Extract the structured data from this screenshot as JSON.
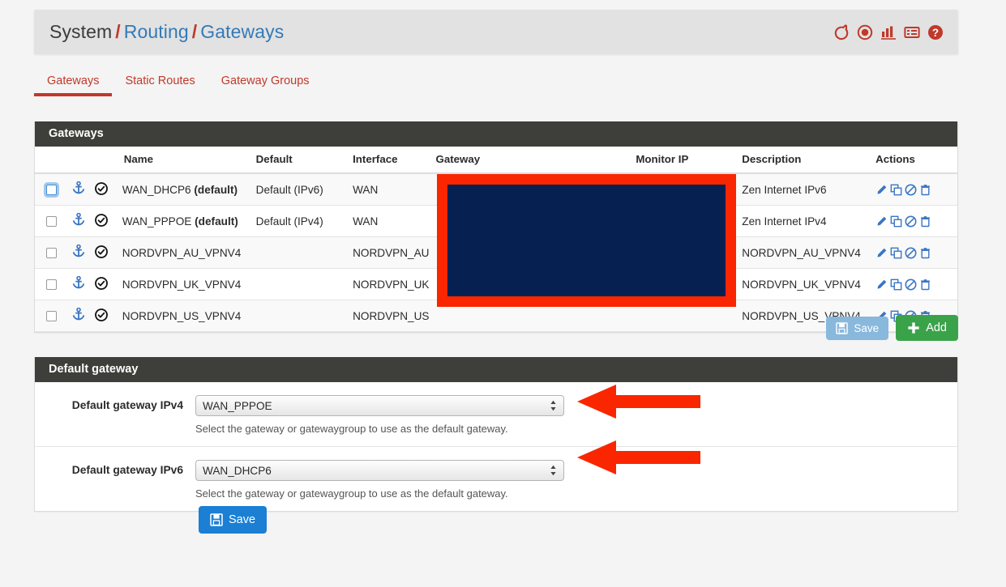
{
  "breadcrumb": {
    "root": "System",
    "sep": "/",
    "mid": "Routing",
    "leaf": "Gateways"
  },
  "header_icons": [
    {
      "name": "refresh-icon"
    },
    {
      "name": "record-stop-icon"
    },
    {
      "name": "chart-icon"
    },
    {
      "name": "log-icon"
    },
    {
      "name": "help-icon"
    }
  ],
  "tabs": [
    {
      "label": "Gateways",
      "active": true
    },
    {
      "label": "Static Routes",
      "active": false
    },
    {
      "label": "Gateway Groups",
      "active": false
    }
  ],
  "gateways_panel": {
    "title": "Gateways",
    "columns": [
      "Name",
      "Default",
      "Interface",
      "Gateway",
      "Monitor IP",
      "Description",
      "Actions"
    ],
    "rows": [
      {
        "name": "WAN_DHCP6",
        "name_suffix": "(default)",
        "default": "Default (IPv6)",
        "interface": "WAN",
        "gateway": "",
        "monitor_ip": "",
        "description": "Zen Internet IPv6",
        "checkbox_focused": true
      },
      {
        "name": "WAN_PPPOE",
        "name_suffix": "(default)",
        "default": "Default (IPv4)",
        "interface": "WAN",
        "gateway": "",
        "monitor_ip": "",
        "description": "Zen Internet IPv4",
        "checkbox_focused": false
      },
      {
        "name": "NORDVPN_AU_VPNV4",
        "name_suffix": "",
        "default": "",
        "interface": "NORDVPN_AU",
        "gateway": "",
        "monitor_ip": "",
        "description": "NORDVPN_AU_VPNV4",
        "checkbox_focused": false
      },
      {
        "name": "NORDVPN_UK_VPNV4",
        "name_suffix": "",
        "default": "",
        "interface": "NORDVPN_UK",
        "gateway": "",
        "monitor_ip": "",
        "description": "NORDVPN_UK_VPNV4",
        "checkbox_focused": false
      },
      {
        "name": "NORDVPN_US_VPNV4",
        "name_suffix": "",
        "default": "",
        "interface": "NORDVPN_US",
        "gateway": "",
        "monitor_ip": "",
        "description": "NORDVPN_US_VPNV4",
        "checkbox_focused": false
      }
    ],
    "row_action_icons": [
      "edit-pencil-icon",
      "copy-icon",
      "disable-ban-icon",
      "delete-trash-icon"
    ],
    "save_label": "Save",
    "add_label": "Add"
  },
  "default_gateway_panel": {
    "title": "Default gateway",
    "ipv4": {
      "label": "Default gateway IPv4",
      "value": "WAN_PPPOE",
      "help": "Select the gateway or gatewaygroup to use as the default gateway."
    },
    "ipv6": {
      "label": "Default gateway IPv6",
      "value": "WAN_DHCP6",
      "help": "Select the gateway or gatewaygroup to use as the default gateway."
    }
  },
  "footer": {
    "save_label": "Save"
  },
  "annotations": {
    "redaction_fill": "#062052",
    "redaction_border": "#fa2600",
    "arrow_color": "#fa2600",
    "arrow_count": 2
  },
  "colors": {
    "accent_red": "#c0392b",
    "link_blue": "#337ab7",
    "panel_header": "#3e3f3a",
    "add_green": "#3aa34a",
    "save_blue": "#1b7fd4"
  }
}
